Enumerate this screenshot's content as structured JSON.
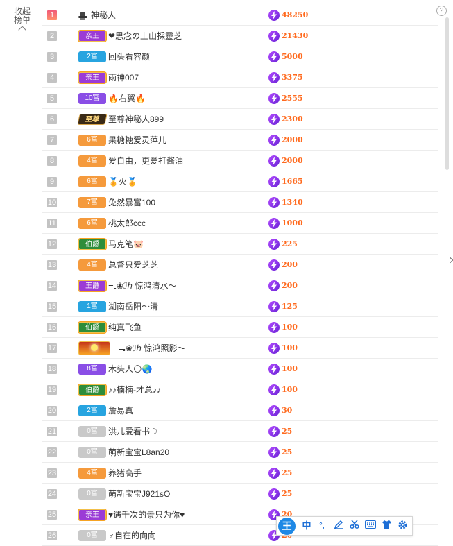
{
  "collapse": {
    "label": "收起榜单"
  },
  "help": {
    "label": "?"
  },
  "ime": {
    "logo": "王",
    "lang": "中",
    "punct": "°,"
  },
  "colors": {
    "score": "#ff6a1e",
    "bolt": "#8a3df0",
    "accent": "#1e88e5"
  },
  "rows": [
    {
      "rank": "1",
      "badge_type": "hat",
      "badge": "",
      "name": "神秘人",
      "score": "48250"
    },
    {
      "rank": "2",
      "badge_type": "wang",
      "badge": "亲王",
      "name": "❤思念の上山採靈芝",
      "score": "21430"
    },
    {
      "rank": "3",
      "badge_type": "fu-blue",
      "badge": "2富",
      "name": "回头看容颜",
      "score": "5000"
    },
    {
      "rank": "4",
      "badge_type": "wang",
      "badge": "亲王",
      "name": "雨神007",
      "score": "3375"
    },
    {
      "rank": "5",
      "badge_type": "fu-purple",
      "badge": "10富",
      "name": "🔥右翼🔥",
      "score": "2555"
    },
    {
      "rank": "6",
      "badge_type": "zhizun",
      "badge": "至尊",
      "name": "至尊神秘人899",
      "score": "2300"
    },
    {
      "rank": "7",
      "badge_type": "fu-orange",
      "badge": "6富",
      "name": "果糖糖爱灵萍儿",
      "score": "2000"
    },
    {
      "rank": "8",
      "badge_type": "fu-orange",
      "badge": "4富",
      "name": "爱自由，更爱打酱油",
      "score": "2000"
    },
    {
      "rank": "9",
      "badge_type": "fu-orange",
      "badge": "6富",
      "name": "🏅火🏅",
      "score": "1665"
    },
    {
      "rank": "10",
      "badge_type": "fu-orange",
      "badge": "7富",
      "name": "免然暴富100",
      "score": "1340"
    },
    {
      "rank": "11",
      "badge_type": "fu-orange",
      "badge": "6富",
      "name": "桃太郎ccc",
      "score": "1000"
    },
    {
      "rank": "12",
      "badge_type": "bojue",
      "badge": "伯爵",
      "name": "马克笔🐷",
      "score": "225"
    },
    {
      "rank": "13",
      "badge_type": "fu-orange",
      "badge": "4富",
      "name": "总督只爱芝芝",
      "score": "200"
    },
    {
      "rank": "14",
      "badge_type": "wang",
      "badge": "王爵",
      "name": "ᯓ❀ℐℎ 惊鸿清水～",
      "score": "200"
    },
    {
      "rank": "15",
      "badge_type": "fu-blue",
      "badge": "1富",
      "name": "湖南岳阳～清",
      "score": "125"
    },
    {
      "rank": "16",
      "badge_type": "bojue",
      "badge": "伯爵",
      "name": "纯真飞鱼",
      "score": "100"
    },
    {
      "rank": "17",
      "badge_type": "crown",
      "badge": "",
      "name": "ᯓ❀ℐℎ 惊鸿照影～",
      "score": "100"
    },
    {
      "rank": "18",
      "badge_type": "fu-purple",
      "badge": "8富",
      "name": "木头人😑🌏",
      "score": "100"
    },
    {
      "rank": "19",
      "badge_type": "bojue",
      "badge": "伯爵",
      "name": "♪♪楠楠-才总♪♪",
      "score": "100"
    },
    {
      "rank": "20",
      "badge_type": "fu-blue",
      "badge": "2富",
      "name": "詹易真",
      "score": "30"
    },
    {
      "rank": "21",
      "badge_type": "fu-gray",
      "badge": "0富",
      "name": "洪儿爱看书☽",
      "score": "25"
    },
    {
      "rank": "22",
      "badge_type": "fu-gray",
      "badge": "0富",
      "name": "萌新宝宝L8an20",
      "score": "25"
    },
    {
      "rank": "23",
      "badge_type": "fu-orange",
      "badge": "4富",
      "name": "养猪高手",
      "score": "25"
    },
    {
      "rank": "24",
      "badge_type": "fu-gray",
      "badge": "0富",
      "name": "萌新宝宝J921sO",
      "score": "25"
    },
    {
      "rank": "25",
      "badge_type": "wang",
      "badge": "亲王",
      "name": "♥遇千次的景只为你♥",
      "score": "20"
    },
    {
      "rank": "26",
      "badge_type": "fu-gray",
      "badge": "0富",
      "name": "♂自在的向向",
      "score": "20"
    }
  ]
}
